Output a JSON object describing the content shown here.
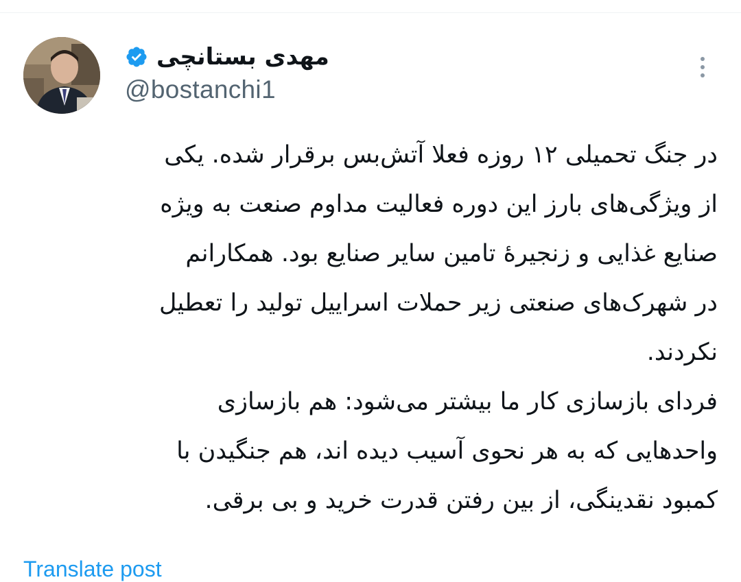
{
  "author": {
    "display_name": "مهدی بستانچی",
    "handle": "@bostanchi1",
    "verified_badge_color": "#1d9bf0",
    "avatar_icon": "profile-photo"
  },
  "more_icon": "more-vertical-icon",
  "tweet": {
    "lines": [
      "در جنگ تحمیلی ۱۲ روزه فعلا آتش‌بس برقرار شده. یکی",
      "از ویژگی‌های بارز این دوره فعالیت مداوم صنعت به ویژه",
      "صنایع غذایی و زنجیرهٔ  تامین سایر صنایع بود. همکارانم",
      "در شهرک‌های صنعتی زیر حملات اسراییل تولید را تعطیل",
      "نکردند.",
      "فردای بازسازی کار ما بیشتر می‌شود: هم بازسازی",
      "واحدهایی که به هر نحوی آسیب دیده اند، هم جنگیدن با",
      "کمبود نقدینگی، از بین رفتن قدرت خرید و بی برقی."
    ]
  },
  "actions": {
    "translate_label": "Translate post"
  },
  "colors": {
    "text": "#0f1419",
    "secondary": "#536471",
    "accent": "#1d9bf0"
  }
}
